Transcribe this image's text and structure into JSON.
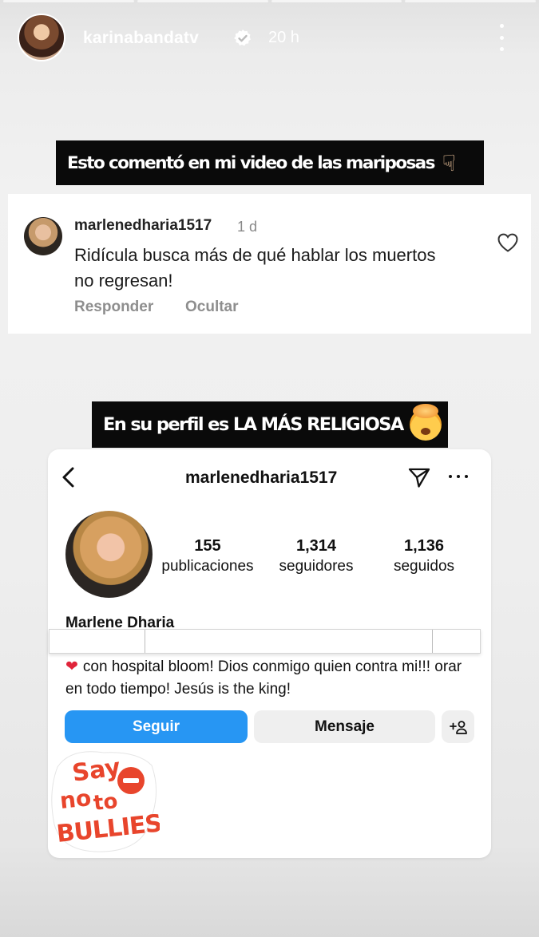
{
  "story": {
    "username": "karinabandatv",
    "time": "20 h",
    "progress_segments": 4
  },
  "captions": {
    "first": "Esto comentó en mi video de las mariposas",
    "second": "En su perfil es LA MÁS RELIGIOSA"
  },
  "comment": {
    "username": "marlenedharia1517",
    "time": "1 d",
    "text": "Ridícula busca más de qué hablar los muertos no regresan!",
    "reply_label": "Responder",
    "hide_label": "Ocultar"
  },
  "profile": {
    "username": "marlenedharia1517",
    "stats": [
      {
        "value": "155",
        "label": "publicaciones"
      },
      {
        "value": "1,314",
        "label": "seguidores"
      },
      {
        "value": "1,136",
        "label": "seguidos"
      }
    ],
    "name": "Marlene Dharia",
    "bio": "con hospital bloom! Dios conmigo quien contra mi!!! orar en todo tiempo! Jesús is the king!",
    "follow_label": "Seguir",
    "message_label": "Mensaje"
  },
  "sticker": {
    "text": "Say no to BULLIES"
  },
  "colors": {
    "follow_blue": "#2796f3",
    "sticker_red": "#e8452c",
    "heart_red": "#e0243a"
  }
}
